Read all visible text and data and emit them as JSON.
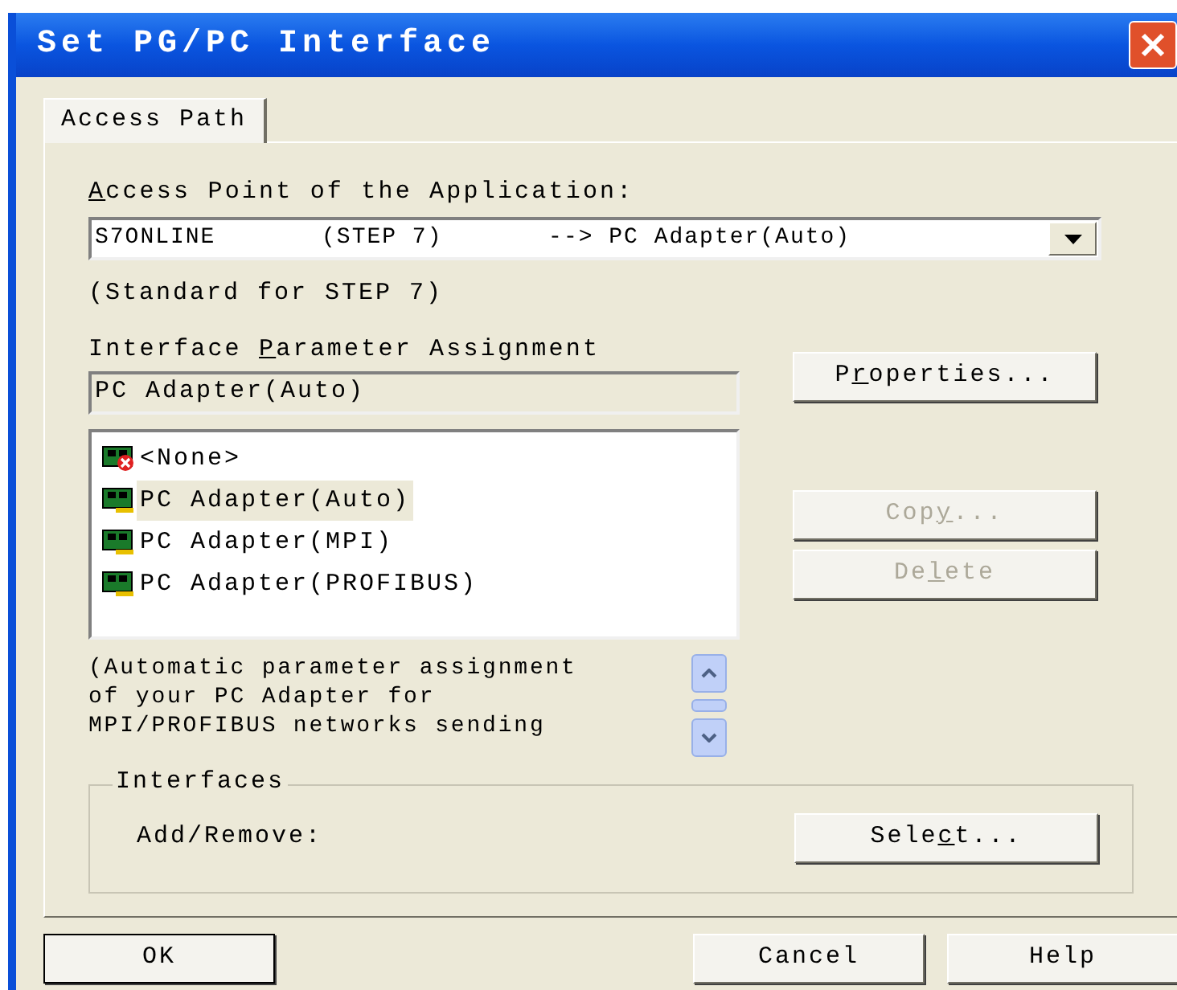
{
  "window": {
    "title": "Set PG/PC Interface"
  },
  "tabs": [
    {
      "label": "Access Path",
      "selected": true
    }
  ],
  "access_point": {
    "label": [
      {
        "text": "A",
        "underlined": true
      },
      {
        "text": "ccess Point of the Application:",
        "underlined": false
      }
    ],
    "value": "S7ONLINE       (STEP 7)       --> PC Adapter(Auto)",
    "note": "(Standard for STEP 7)"
  },
  "parameter_assignment": {
    "label": [
      {
        "text": "Interface ",
        "underlined": false
      },
      {
        "text": "P",
        "underlined": true
      },
      {
        "text": "arameter Assignment",
        "underlined": false
      }
    ],
    "value": "PC Adapter(Auto)"
  },
  "interfaces_list": [
    {
      "label": "<None>",
      "kind": "none",
      "selected": false
    },
    {
      "label": "PC Adapter(Auto)",
      "kind": "adapter",
      "selected": true
    },
    {
      "label": "PC Adapter(MPI)",
      "kind": "adapter",
      "selected": false
    },
    {
      "label": "PC Adapter(PROFIBUS)",
      "kind": "adapter",
      "selected": false
    }
  ],
  "side_buttons": [
    {
      "label": [
        {
          "text": "P",
          "underlined": false
        },
        {
          "text": "r",
          "underlined": true
        },
        {
          "text": "operties...",
          "underlined": false
        }
      ],
      "disabled": false
    },
    {
      "label": [
        {
          "text": "Cop",
          "underlined": false
        },
        {
          "text": "y",
          "underlined": true
        },
        {
          "text": "...",
          "underlined": false
        }
      ],
      "disabled": true
    },
    {
      "label": [
        {
          "text": "De",
          "underlined": false
        },
        {
          "text": "l",
          "underlined": true
        },
        {
          "text": "ete",
          "underlined": false
        }
      ],
      "disabled": true
    }
  ],
  "description": "(Automatic parameter assignment\nof your PC Adapter for\nMPI/PROFIBUS networks sending",
  "interfaces_group": {
    "title": "Interfaces",
    "label": "Add/Remove:",
    "button": {
      "label": [
        {
          "text": "Sele",
          "underlined": false
        },
        {
          "text": "c",
          "underlined": true
        },
        {
          "text": "t...",
          "underlined": false
        }
      ]
    }
  },
  "footer_buttons": [
    "OK",
    "Cancel",
    "Help"
  ]
}
